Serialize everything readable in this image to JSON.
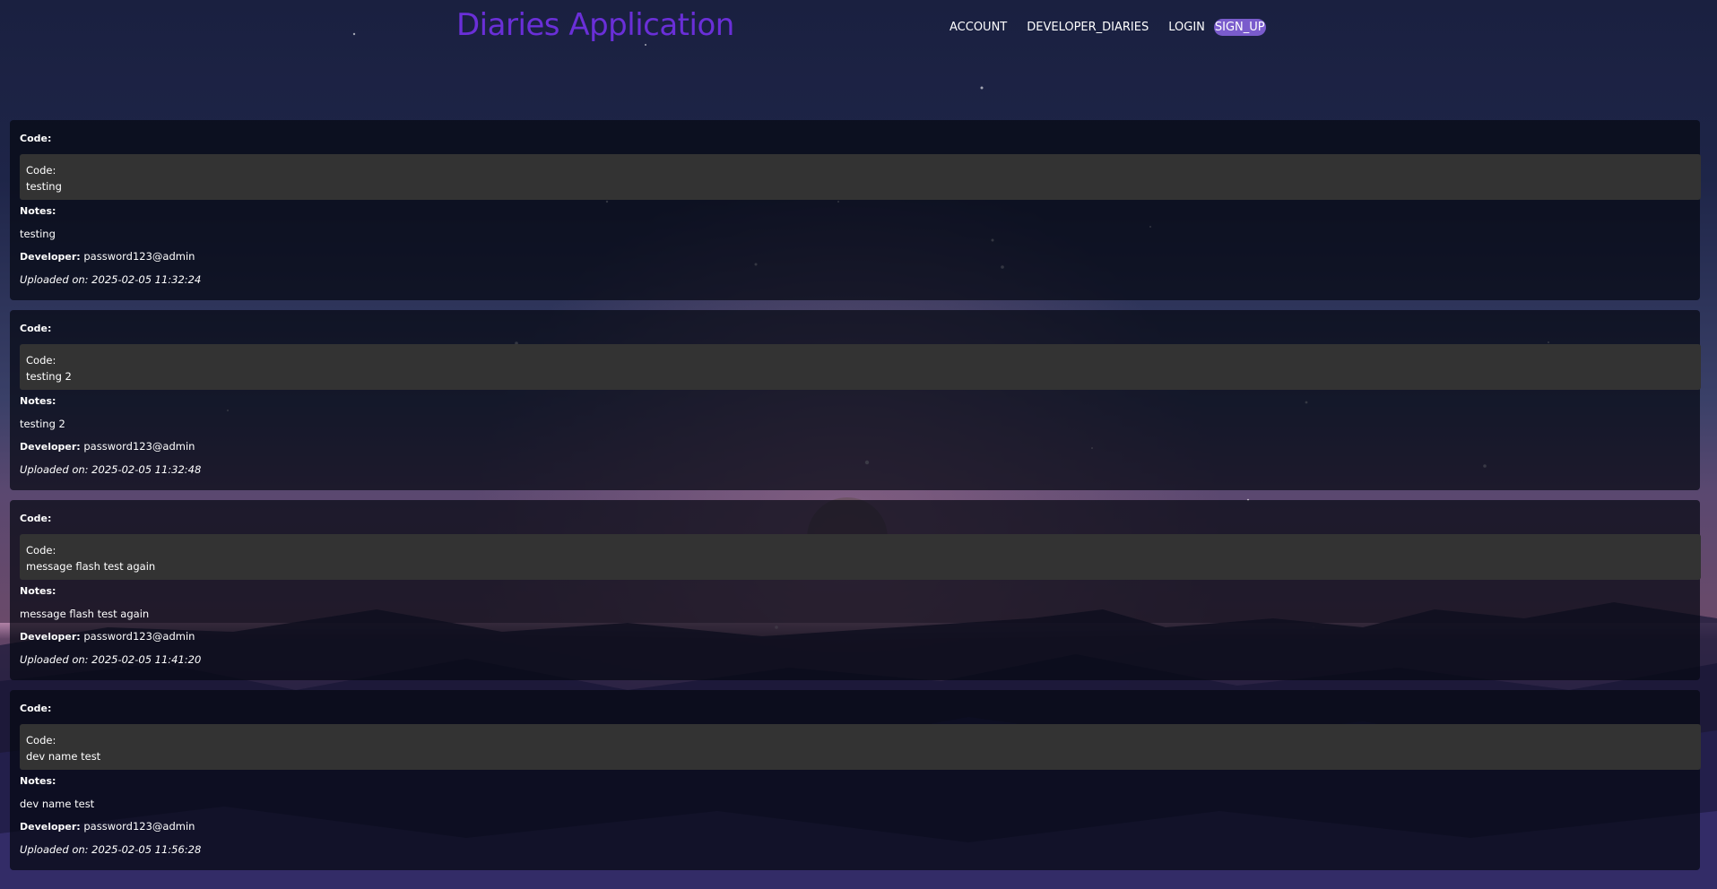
{
  "header": {
    "title": "Diaries Application",
    "nav": {
      "account": "ACCOUNT",
      "developer_diaries": "DEVELOPER_DIARIES",
      "login": "LOGIN",
      "sign_up": "SIGN_UP"
    }
  },
  "labels": {
    "code": "Code:",
    "code_box": "Code:",
    "notes": "Notes:",
    "developer": "Developer:"
  },
  "entries": [
    {
      "code": "testing",
      "notes": "testing",
      "developer": "password123@admin",
      "uploaded": "Uploaded on: 2025-02-05 11:32:24"
    },
    {
      "code": "testing 2",
      "notes": "testing 2",
      "developer": "password123@admin",
      "uploaded": "Uploaded on: 2025-02-05 11:32:48"
    },
    {
      "code": "message flash test again",
      "notes": "message flash test again",
      "developer": "password123@admin",
      "uploaded": "Uploaded on: 2025-02-05 11:41:20"
    },
    {
      "code": "dev name test",
      "notes": "dev name test",
      "developer": "password123@admin",
      "uploaded": "Uploaded on: 2025-02-05 11:56:28"
    }
  ],
  "colors": {
    "title": "#6a2fd8",
    "signup_bg": "#7a5ccc",
    "code_box_bg": "#333333"
  }
}
